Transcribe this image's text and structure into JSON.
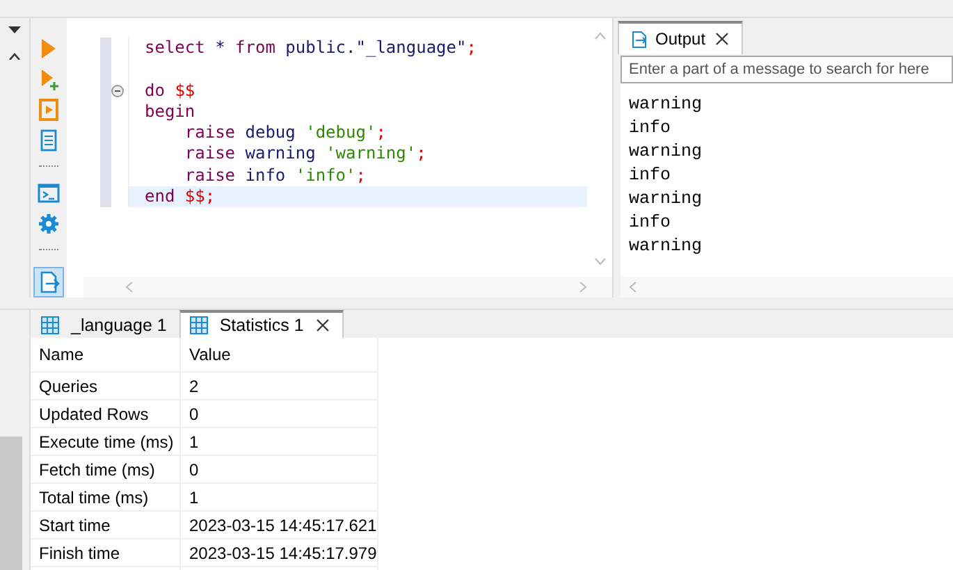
{
  "editor": {
    "lines": [
      {
        "current": false,
        "fold_marker": false,
        "tokens": [
          {
            "kind": "keyword",
            "text": "select"
          },
          {
            "kind": "plain",
            "text": " * "
          },
          {
            "kind": "keyword",
            "text": "from"
          },
          {
            "kind": "plain",
            "text": " public.\"_language\""
          },
          {
            "kind": "punct",
            "text": ";"
          }
        ]
      },
      {
        "current": false,
        "fold_marker": false
      },
      {
        "current": false,
        "fold_marker": true,
        "tokens": [
          {
            "kind": "keyword",
            "text": "do "
          },
          {
            "kind": "punct",
            "text": "$$"
          }
        ]
      },
      {
        "current": false,
        "fold_marker": false,
        "tokens": [
          {
            "kind": "keyword",
            "text": "begin"
          }
        ]
      },
      {
        "current": false,
        "fold_marker": false,
        "tokens": [
          {
            "kind": "keyword",
            "text": "    raise"
          },
          {
            "kind": "plain",
            "text": " debug "
          },
          {
            "kind": "string",
            "text": "'debug'"
          },
          {
            "kind": "punct",
            "text": ";"
          }
        ]
      },
      {
        "current": false,
        "fold_marker": false,
        "tokens": [
          {
            "kind": "keyword",
            "text": "    raise"
          },
          {
            "kind": "plain",
            "text": " warning "
          },
          {
            "kind": "string",
            "text": "'warning'"
          },
          {
            "kind": "punct",
            "text": ";"
          }
        ]
      },
      {
        "current": false,
        "fold_marker": false,
        "tokens": [
          {
            "kind": "keyword",
            "text": "    raise"
          },
          {
            "kind": "plain",
            "text": " info "
          },
          {
            "kind": "string",
            "text": "'info'"
          },
          {
            "kind": "punct",
            "text": ";"
          }
        ]
      },
      {
        "current": true,
        "fold_marker": false,
        "tokens": [
          {
            "kind": "keyword",
            "text": "end "
          },
          {
            "kind": "punct",
            "text": "$$;"
          }
        ]
      }
    ]
  },
  "output": {
    "tab": {
      "label": "Output",
      "selected": true
    },
    "search": {
      "placeholder": "Enter a part of a message to search for here"
    },
    "lines": [
      "warning",
      "info",
      "warning",
      "info",
      "warning",
      "info",
      "warning"
    ]
  },
  "results": {
    "tabs": [
      {
        "label": "_language 1",
        "selected": false,
        "closable": false
      },
      {
        "label": "Statistics 1",
        "selected": true,
        "closable": true
      }
    ],
    "columns": [
      "Name",
      "Value"
    ],
    "rows": [
      [
        "Queries",
        "2"
      ],
      [
        "Updated Rows",
        "0"
      ],
      [
        "Execute time (ms)",
        "1"
      ],
      [
        "Fetch time (ms)",
        "0"
      ],
      [
        "Total time (ms)",
        "1"
      ],
      [
        "Start time",
        "2023-03-15 14:45:17.621"
      ],
      [
        "Finish time",
        "2023-03-15 14:45:17.979"
      ]
    ]
  }
}
